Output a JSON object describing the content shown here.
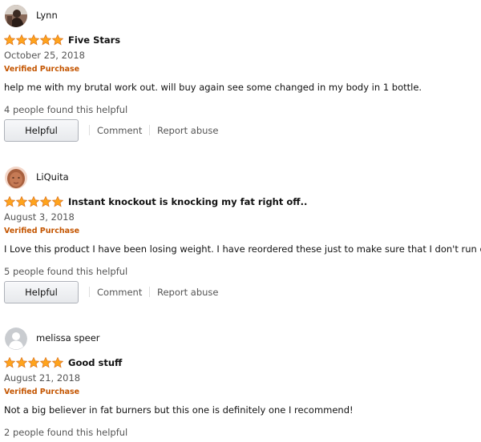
{
  "reviews": [
    {
      "username": "Lynn",
      "rating": 5,
      "title": "Five Stars",
      "date": "October 25, 2018",
      "verified": "Verified Purchase",
      "body": "help me with my brutal work out. will buy again see some changed in my body in 1 bottle.",
      "helpful_count": "4 people found this helpful",
      "helpful_label": "Helpful",
      "comment_label": "Comment",
      "report_label": "Report abuse"
    },
    {
      "username": "LiQuita",
      "rating": 5,
      "title": "Instant knockout is knocking my fat right off..",
      "date": "August 3, 2018",
      "verified": "Verified Purchase",
      "body": "I Love this product I have been losing weight. I have reordered these just to make sure that I don't run out.",
      "helpful_count": "5 people found this helpful",
      "helpful_label": "Helpful",
      "comment_label": "Comment",
      "report_label": "Report abuse"
    },
    {
      "username": "melissa speer",
      "rating": 5,
      "title": "Good stuff",
      "date": "August 21, 2018",
      "verified": "Verified Purchase",
      "body": "Not a big believer in fat burners but this one is definitely one I recommend!",
      "helpful_count": "2 people found this helpful"
    }
  ],
  "colors": {
    "star": "#ffa41c",
    "verified": "#c45500",
    "link": "#555555"
  }
}
